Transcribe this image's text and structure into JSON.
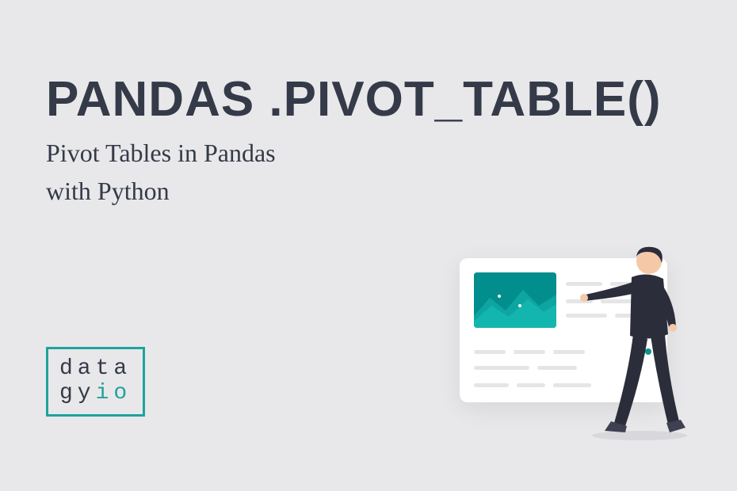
{
  "title": "PANDAS .PIVOT_TABLE()",
  "subtitle_line1": "Pivot Tables in Pandas",
  "subtitle_line2": "with Python",
  "logo": {
    "line1": "data",
    "line2_part1": "gy",
    "line2_part2": "io"
  },
  "colors": {
    "background": "#e8e8ea",
    "text": "#353a48",
    "accent": "#1fa39c",
    "chart_bg": "#018e8c",
    "chart_mountain": "#14b8a6"
  }
}
